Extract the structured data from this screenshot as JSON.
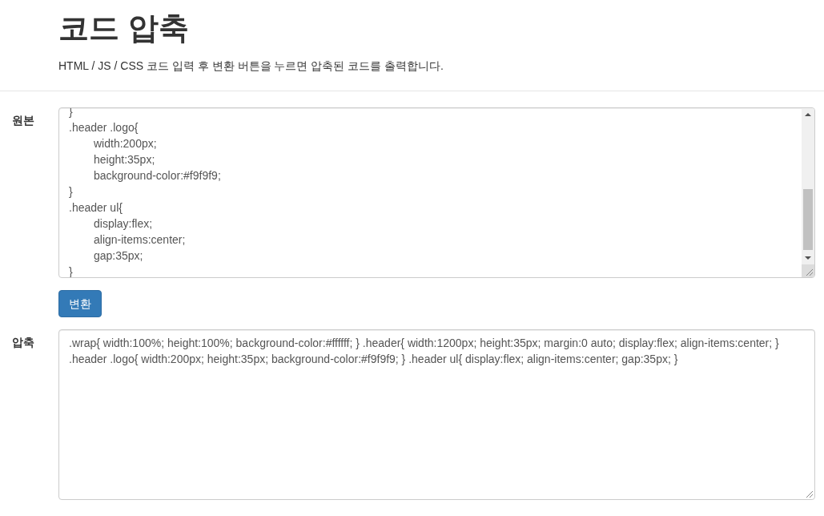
{
  "header": {
    "title": "코드 압축",
    "description": "HTML / JS / CSS 코드 입력 후 변환 버튼을 누르면 압축된 코드를 출력합니다."
  },
  "source": {
    "label": "원본",
    "lines": [
      {
        "text": "}"
      },
      {
        "text": ".header .logo{",
        "children": [
          "width:200px;",
          "height:35px;",
          "background-color:#f9f9f9;"
        ]
      },
      {
        "text": "}"
      },
      {
        "text": ".header ul{",
        "children": [
          "display:flex;",
          "align-items:center;",
          "gap:35px;"
        ]
      },
      {
        "text": "}"
      }
    ]
  },
  "convert_button": "변환",
  "output": {
    "label": "압축",
    "value": ".wrap{ width:100%; height:100%; background-color:#ffffff; } .header{ width:1200px; height:35px; margin:0 auto; display:flex; align-items:center; } .header .logo{ width:200px; height:35px; background-color:#f9f9f9; } .header ul{ display:flex; align-items:center; gap:35px; }"
  }
}
